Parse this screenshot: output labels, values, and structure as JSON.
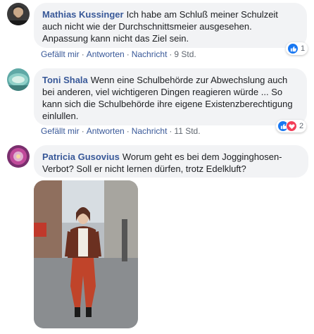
{
  "comments": [
    {
      "author": "Mathias Kussinger",
      "text": "Ich habe am Schluß meiner Schulzeit auch nicht wie der Durchschnittsmeier ausgesehen. Anpassung kann nicht das Ziel sein.",
      "actions": {
        "like": "Gefällt mir",
        "reply": "Antworten",
        "message": "Nachricht",
        "time": "9 Std."
      },
      "reaction_count": "1",
      "reaction_icons": [
        "like-icon"
      ]
    },
    {
      "author": "Toni Shala",
      "text": "Wenn eine Schulbehörde zur Abwechslung auch bei anderen, viel wichtigeren Dingen reagieren würde ... So kann sich die Schulbehörde ihre eigene Existenzberechtigung einlullen.",
      "actions": {
        "like": "Gefällt mir",
        "reply": "Antworten",
        "message": "Nachricht",
        "time": "11 Std."
      },
      "reaction_count": "2",
      "reaction_icons": [
        "like-icon",
        "love-icon"
      ]
    },
    {
      "author": "Patricia Gusovius",
      "text": "Worum geht es bei dem Jogginghosen-Verbot? Soll er nicht lernen dürfen, trotz Edelkluft?",
      "attachment": "photo-woman-street-red-trousers"
    }
  ],
  "separator": "·",
  "colors": {
    "link": "#385898",
    "bubble": "#f2f3f5",
    "meta": "#606770",
    "like": "#1877f2",
    "love": "#f33e58"
  }
}
